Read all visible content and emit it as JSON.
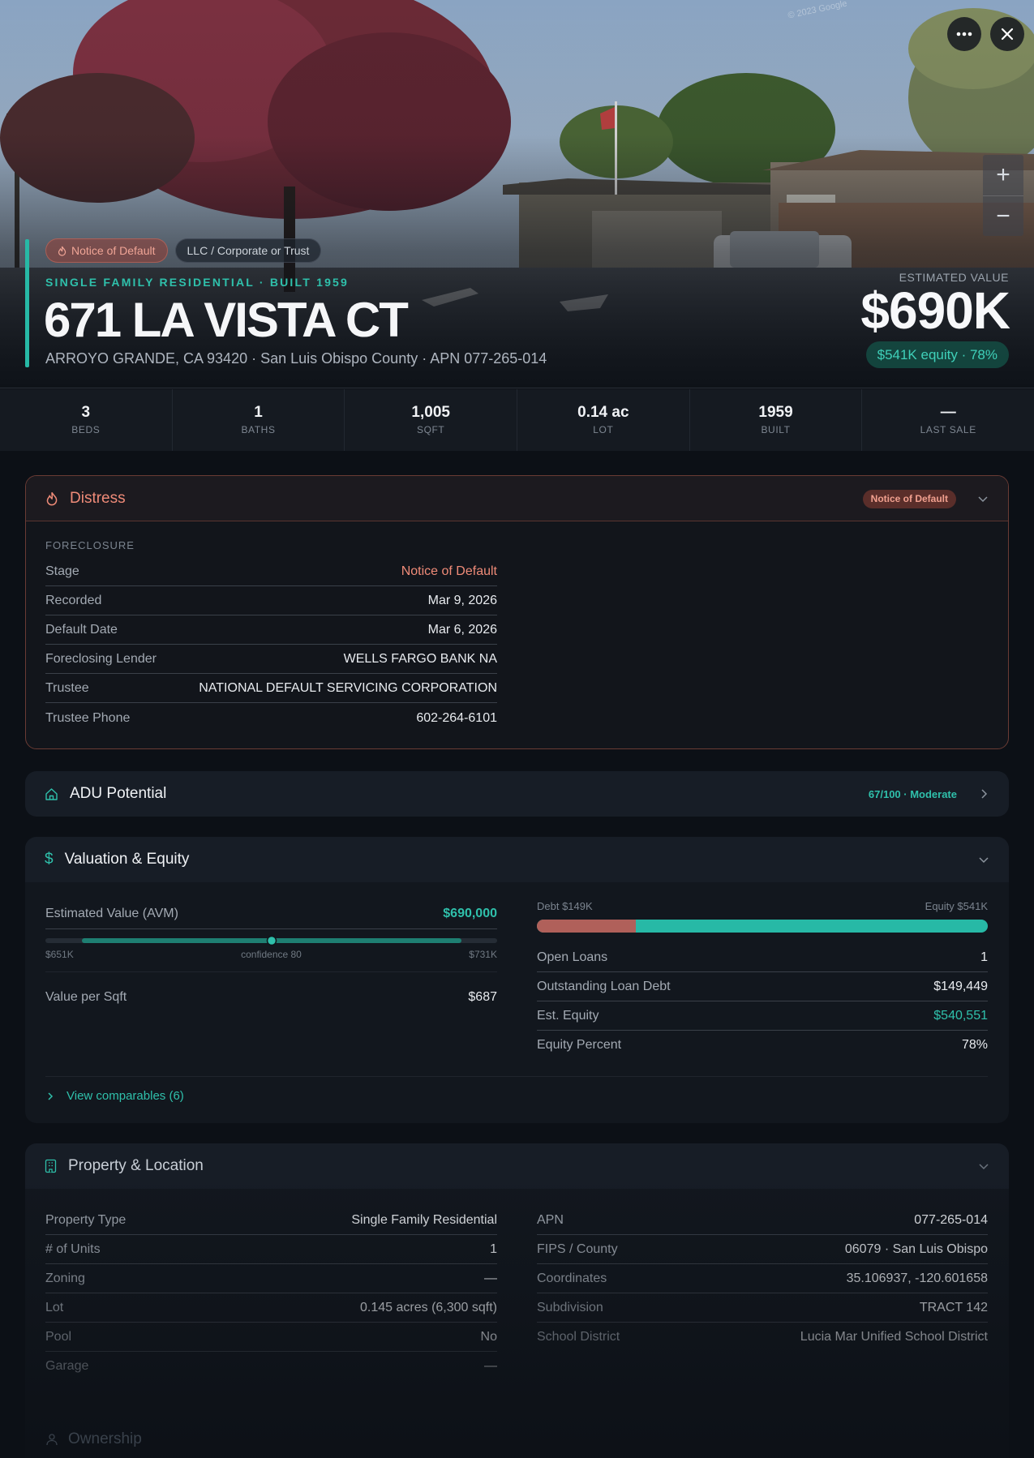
{
  "hero": {
    "watermark": "© 2023 Google",
    "tags": [
      "Notice of Default",
      "LLC / Corporate or Trust"
    ],
    "subtitle": "SINGLE FAMILY RESIDENTIAL · BUILT 1959",
    "title": "671 LA VISTA CT",
    "address": "ARROYO GRANDE, CA 93420 · San Luis Obispo County · APN 077-265-014",
    "estimated_label": "ESTIMATED VALUE",
    "estimated_value": "$690K",
    "equity_badge": "$541K equity · 78%",
    "zoom_in": "+",
    "zoom_out": "−"
  },
  "stats": [
    {
      "value": "3",
      "label": "BEDS"
    },
    {
      "value": "1",
      "label": "BATHS"
    },
    {
      "value": "1,005",
      "label": "SQFT"
    },
    {
      "value": "0.14 ac",
      "label": "LOT"
    },
    {
      "value": "1959",
      "label": "BUILT"
    },
    {
      "value": "—",
      "label": "LAST SALE"
    }
  ],
  "distress": {
    "title": "Distress",
    "badge": "Notice of Default",
    "section": "FORECLOSURE",
    "rows": [
      {
        "k": "Stage",
        "v": "Notice of Default"
      },
      {
        "k": "Recorded",
        "v": "Mar 9, 2026"
      },
      {
        "k": "Default Date",
        "v": "Mar 6, 2026"
      },
      {
        "k": "Foreclosing Lender",
        "v": "WELLS FARGO BANK NA"
      },
      {
        "k": "Trustee",
        "v": "NATIONAL DEFAULT SERVICING CORPORATION"
      },
      {
        "k": "Trustee Phone",
        "v": "602-264-6101"
      }
    ]
  },
  "adu": {
    "title": "ADU Potential",
    "score": "67/100 · Moderate"
  },
  "valuation": {
    "title": "Valuation & Equity",
    "avm_label": "Estimated Value (AVM)",
    "avm_value": "$690,000",
    "range_low": "$651K",
    "range_high": "$731K",
    "confidence": "confidence 80",
    "confidence_fraction": 0.5,
    "per_sqft_label": "Value per Sqft",
    "per_sqft_value": "$687",
    "debt_label": "Debt $149K",
    "equity_label": "Equity $541K",
    "debt_fraction": 0.22,
    "rows": [
      {
        "k": "Open Loans",
        "v": "1"
      },
      {
        "k": "Outstanding Loan Debt",
        "v": "$149,449"
      },
      {
        "k": "Est. Equity",
        "v": "$540,551"
      },
      {
        "k": "Equity Percent",
        "v": "78%"
      }
    ],
    "comparables": "View comparables (6)"
  },
  "property": {
    "title": "Property & Location",
    "left": [
      {
        "k": "Property Type",
        "v": "Single Family Residential"
      },
      {
        "k": "# of Units",
        "v": "1"
      },
      {
        "k": "Zoning",
        "v": "—"
      },
      {
        "k": "Lot",
        "v": "0.145 acres (6,300 sqft)"
      },
      {
        "k": "Pool",
        "v": "No"
      },
      {
        "k": "Garage",
        "v": "—"
      }
    ],
    "right": [
      {
        "k": "APN",
        "v": "077-265-014"
      },
      {
        "k": "FIPS / County",
        "v": "06079 · San Luis Obispo"
      },
      {
        "k": "Coordinates",
        "v": "35.106937, -120.601658"
      },
      {
        "k": "Subdivision",
        "v": "TRACT 142"
      },
      {
        "k": "School District",
        "v": "Lucia Mar Unified School District"
      }
    ]
  },
  "ownership": {
    "title": "Ownership"
  },
  "colors": {
    "accent": "#27b9a6",
    "distress": "#ef8b78",
    "debt": "#c0645a"
  }
}
